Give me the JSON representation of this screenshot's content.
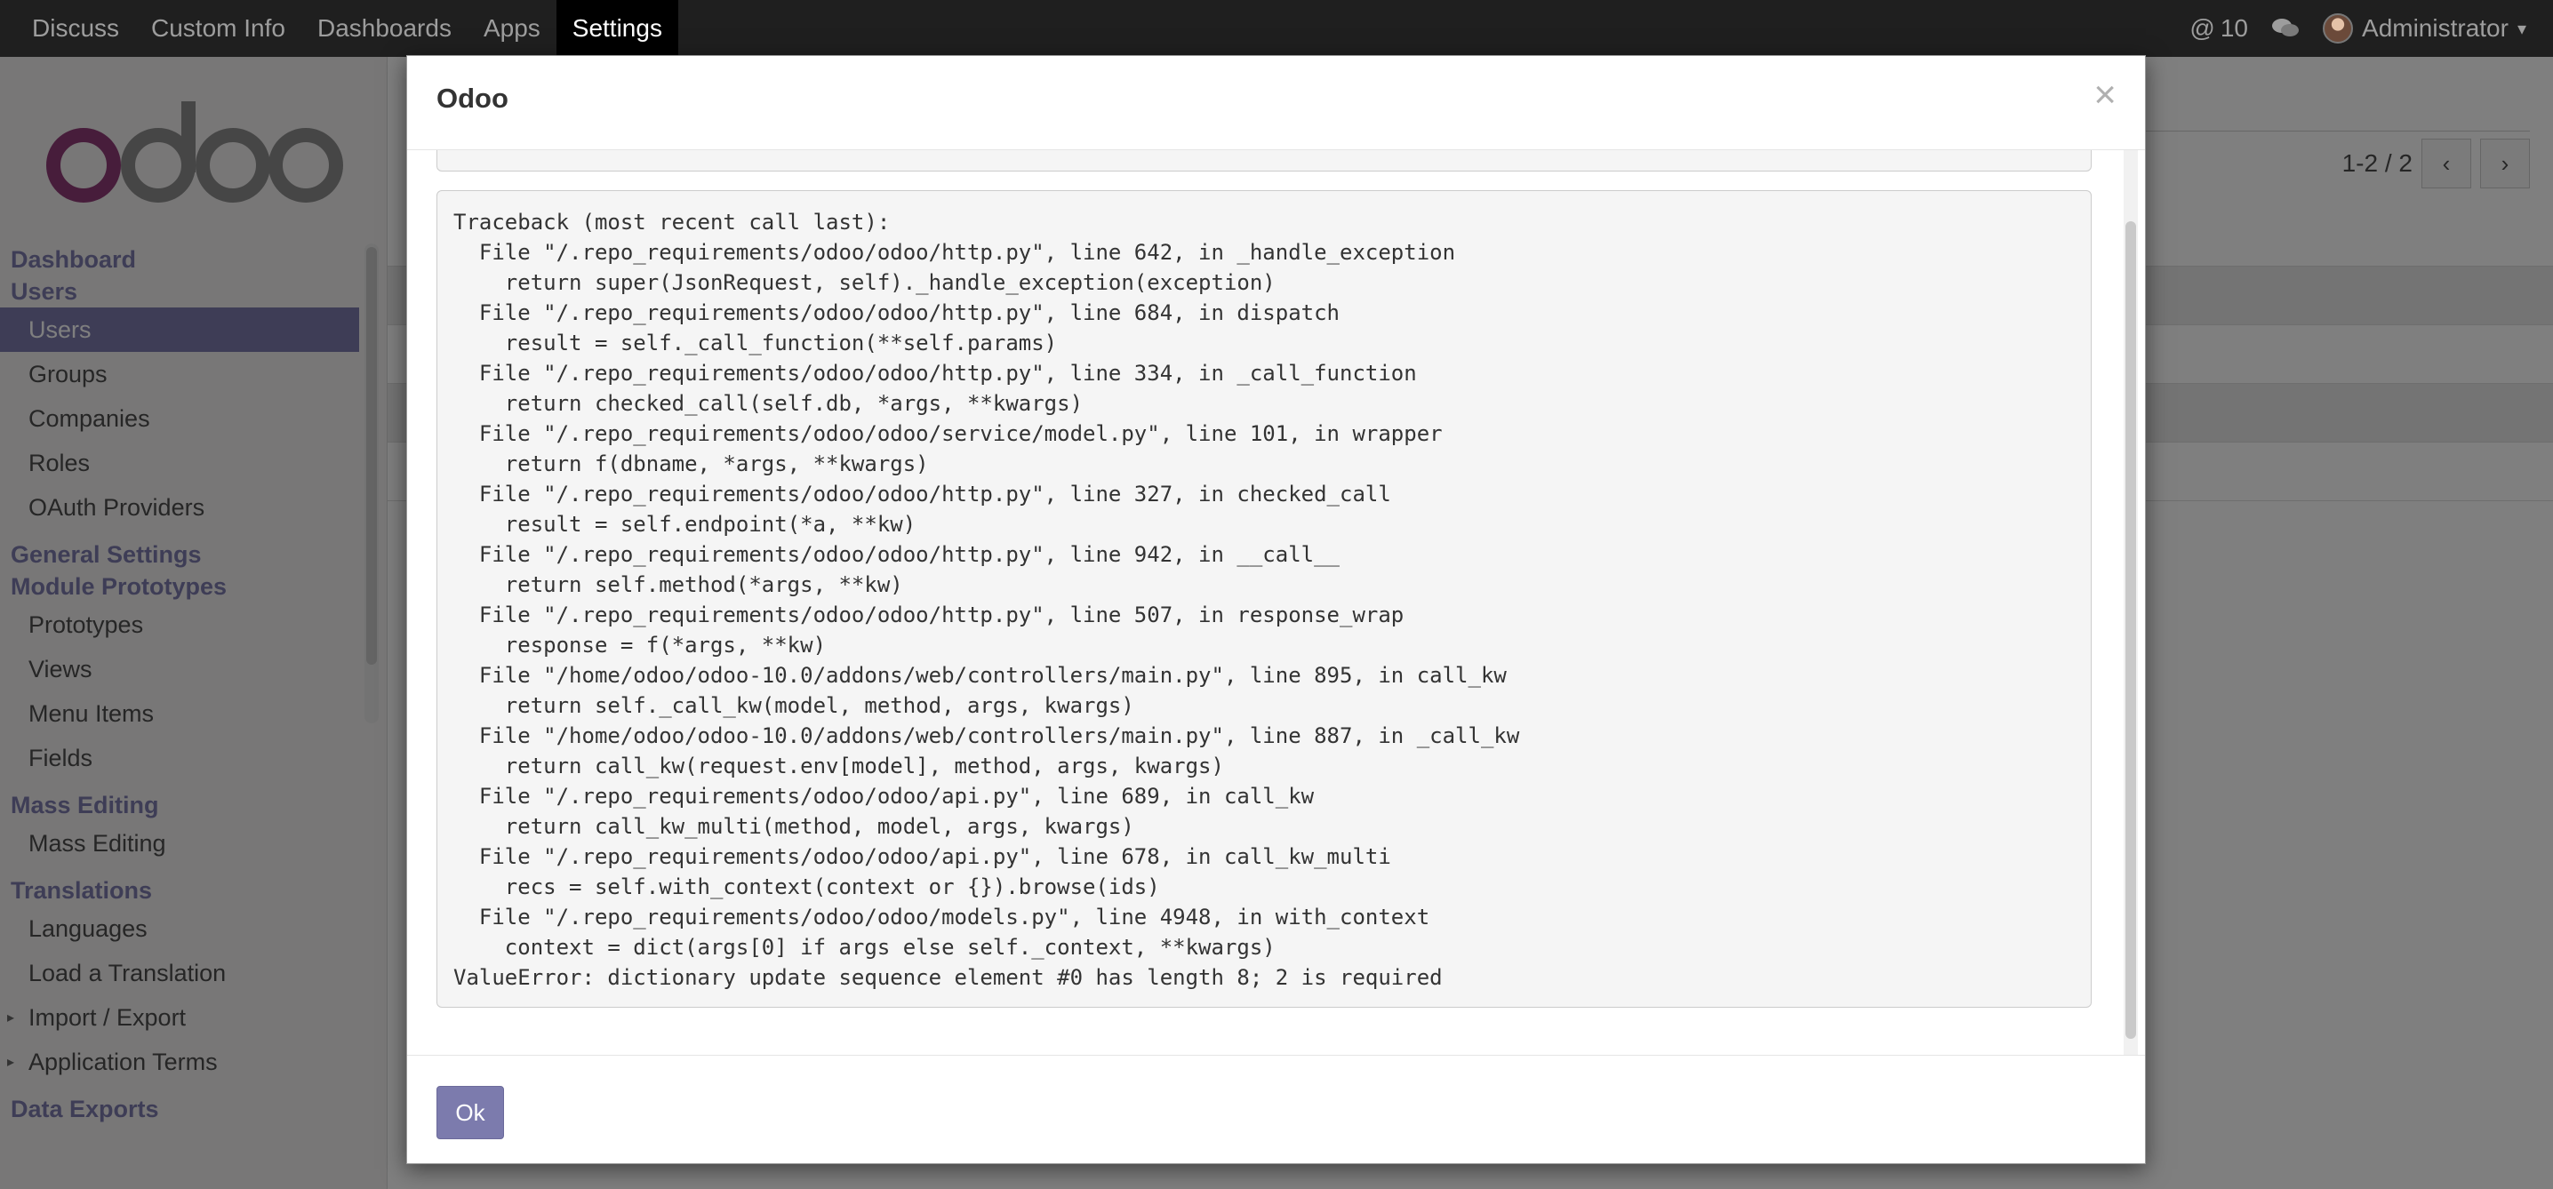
{
  "navbar": {
    "items": [
      {
        "label": "Discuss",
        "active": false
      },
      {
        "label": "Custom Info",
        "active": false
      },
      {
        "label": "Dashboards",
        "active": false
      },
      {
        "label": "Apps",
        "active": false
      },
      {
        "label": "Settings",
        "active": true
      }
    ],
    "mentions_count": "10",
    "user_name": "Administrator"
  },
  "sidebar": {
    "logo_text": "odoo",
    "sections": [
      {
        "heading": "Dashboard",
        "items": []
      },
      {
        "heading": "Users",
        "items": [
          {
            "label": "Users",
            "active": true,
            "expandable": false
          },
          {
            "label": "Groups",
            "active": false,
            "expandable": false
          },
          {
            "label": "Companies",
            "active": false,
            "expandable": false
          },
          {
            "label": "Roles",
            "active": false,
            "expandable": false
          },
          {
            "label": "OAuth Providers",
            "active": false,
            "expandable": false
          }
        ]
      },
      {
        "heading": "General Settings",
        "items": []
      },
      {
        "heading": "Module Prototypes",
        "items": [
          {
            "label": "Prototypes",
            "active": false,
            "expandable": false
          },
          {
            "label": "Views",
            "active": false,
            "expandable": false
          },
          {
            "label": "Menu Items",
            "active": false,
            "expandable": false
          },
          {
            "label": "Fields",
            "active": false,
            "expandable": false
          }
        ]
      },
      {
        "heading": "Mass Editing",
        "items": [
          {
            "label": "Mass Editing",
            "active": false,
            "expandable": false
          }
        ]
      },
      {
        "heading": "Translations",
        "items": [
          {
            "label": "Languages",
            "active": false,
            "expandable": false
          },
          {
            "label": "Load a Translation",
            "active": false,
            "expandable": false
          },
          {
            "label": "Import / Export",
            "active": false,
            "expandable": true
          },
          {
            "label": "Application Terms",
            "active": false,
            "expandable": true
          }
        ]
      },
      {
        "heading": "Data Exports",
        "items": []
      }
    ]
  },
  "background": {
    "pager_text": "1-2 / 2"
  },
  "modal": {
    "title": "Odoo",
    "close_glyph": "×",
    "traceback": [
      "Traceback (most recent call last):",
      "  File \"/.repo_requirements/odoo/odoo/http.py\", line 642, in _handle_exception",
      "    return super(JsonRequest, self)._handle_exception(exception)",
      "  File \"/.repo_requirements/odoo/odoo/http.py\", line 684, in dispatch",
      "    result = self._call_function(**self.params)",
      "  File \"/.repo_requirements/odoo/odoo/http.py\", line 334, in _call_function",
      "    return checked_call(self.db, *args, **kwargs)",
      "  File \"/.repo_requirements/odoo/odoo/service/model.py\", line 101, in wrapper",
      "    return f(dbname, *args, **kwargs)",
      "  File \"/.repo_requirements/odoo/odoo/http.py\", line 327, in checked_call",
      "    result = self.endpoint(*a, **kw)",
      "  File \"/.repo_requirements/odoo/odoo/http.py\", line 942, in __call__",
      "    return self.method(*args, **kw)",
      "  File \"/.repo_requirements/odoo/odoo/http.py\", line 507, in response_wrap",
      "    response = f(*args, **kw)",
      "  File \"/home/odoo/odoo-10.0/addons/web/controllers/main.py\", line 895, in call_kw",
      "    return self._call_kw(model, method, args, kwargs)",
      "  File \"/home/odoo/odoo-10.0/addons/web/controllers/main.py\", line 887, in _call_kw",
      "    return call_kw(request.env[model], method, args, kwargs)",
      "  File \"/.repo_requirements/odoo/odoo/api.py\", line 689, in call_kw",
      "    return call_kw_multi(method, model, args, kwargs)",
      "  File \"/.repo_requirements/odoo/odoo/api.py\", line 678, in call_kw_multi",
      "    recs = self.with_context(context or {}).browse(ids)",
      "  File \"/.repo_requirements/odoo/odoo/models.py\", line 4948, in with_context",
      "    context = dict(args[0] if args else self._context, **kwargs)",
      "ValueError: dictionary update sequence element #0 has length 8; 2 is required"
    ],
    "ok_label": "Ok"
  },
  "colors": {
    "brand": "#7c7bad",
    "navbar": "#1f1f1f",
    "overlay": "rgba(0,0,0,0.5)"
  }
}
